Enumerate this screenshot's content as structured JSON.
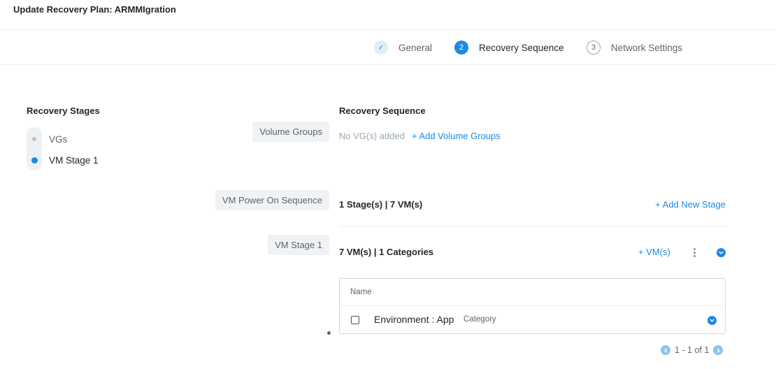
{
  "header": {
    "title": "Update Recovery Plan: ARMMIgration"
  },
  "wizard": {
    "steps": [
      {
        "marker": "✓",
        "label": "General",
        "state": "done"
      },
      {
        "marker": "2",
        "label": "Recovery Sequence",
        "state": "active"
      },
      {
        "marker": "3",
        "label": "Network Settings",
        "state": "pending"
      }
    ]
  },
  "stages": {
    "title": "Recovery Stages",
    "items": [
      {
        "label": "VGs",
        "active": false
      },
      {
        "label": "VM Stage 1",
        "active": true
      }
    ]
  },
  "sequence": {
    "title": "Recovery Sequence",
    "volume_groups": {
      "tag": "Volume Groups",
      "empty_text": "No VG(s) added",
      "add_link": "+ Add Volume Groups"
    },
    "power_on": {
      "tag": "VM Power On Sequence",
      "summary": "1 Stage(s) | 7 VM(s)",
      "add_link": "+ Add New Stage"
    },
    "vm_stage": {
      "tag": "VM Stage 1",
      "summary": "7 VM(s) | 1 Categories",
      "add_vm_link": "+ VM(s)",
      "table": {
        "header": "Name",
        "rows": [
          {
            "name": "Environment : App",
            "badge": "Category"
          }
        ]
      },
      "pagination": "1 - 1 of 1"
    }
  },
  "colors": {
    "accent": "#1b8ae5",
    "text": "#22272e",
    "muted": "#5b6670",
    "tag_bg": "#f0f2f5"
  }
}
